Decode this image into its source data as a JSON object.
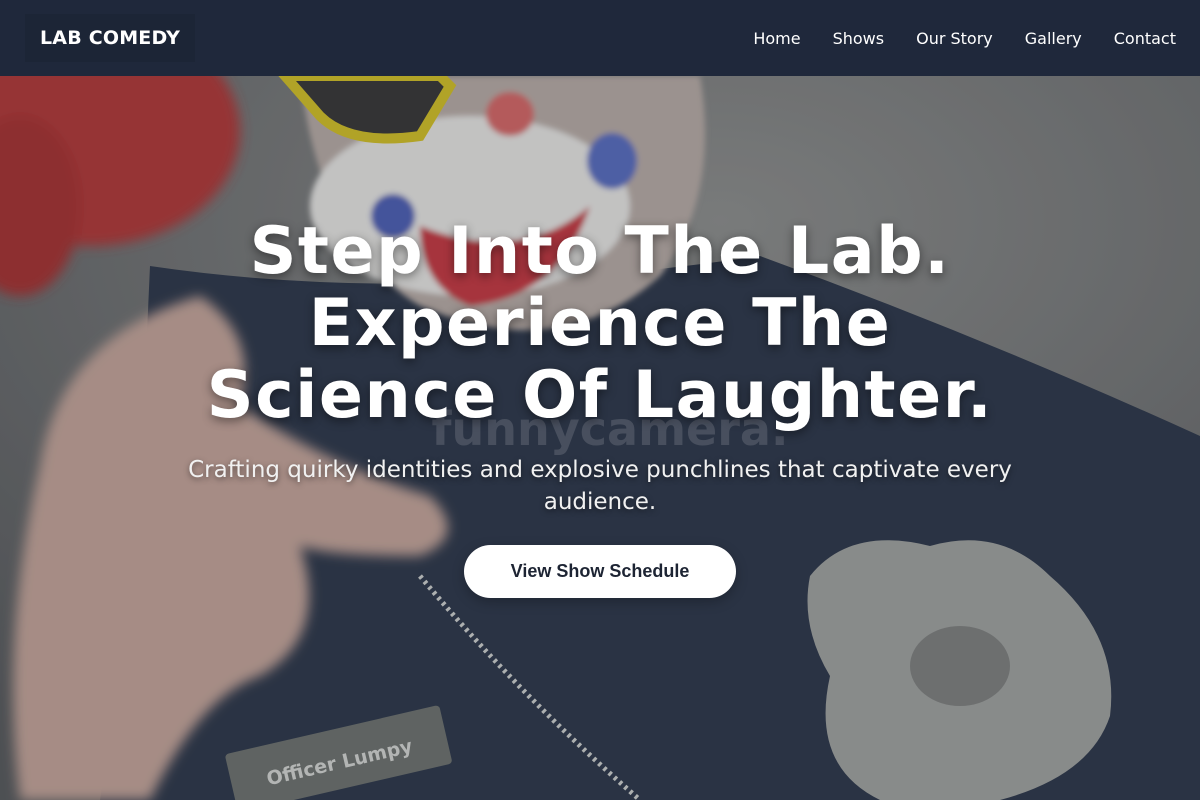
{
  "header": {
    "logo": "LAB COMEDY",
    "nav": [
      {
        "label": "Home"
      },
      {
        "label": "Shows"
      },
      {
        "label": "Our Story"
      },
      {
        "label": "Gallery"
      },
      {
        "label": "Contact"
      }
    ]
  },
  "hero": {
    "title_lines": [
      "Step Into The Lab.",
      "Experience The",
      "Science Of Laughter."
    ],
    "subtitle": "Crafting quirky identities and explosive punchlines that captivate every audience.",
    "cta_label": "View Show Schedule",
    "watermark": "funnycamera.",
    "badge_text": "Officer Lumpy"
  },
  "colors": {
    "header_bg": "#1f283b",
    "text": "#ffffff",
    "cta_bg": "#ffffff",
    "cta_text": "#1d2433"
  }
}
